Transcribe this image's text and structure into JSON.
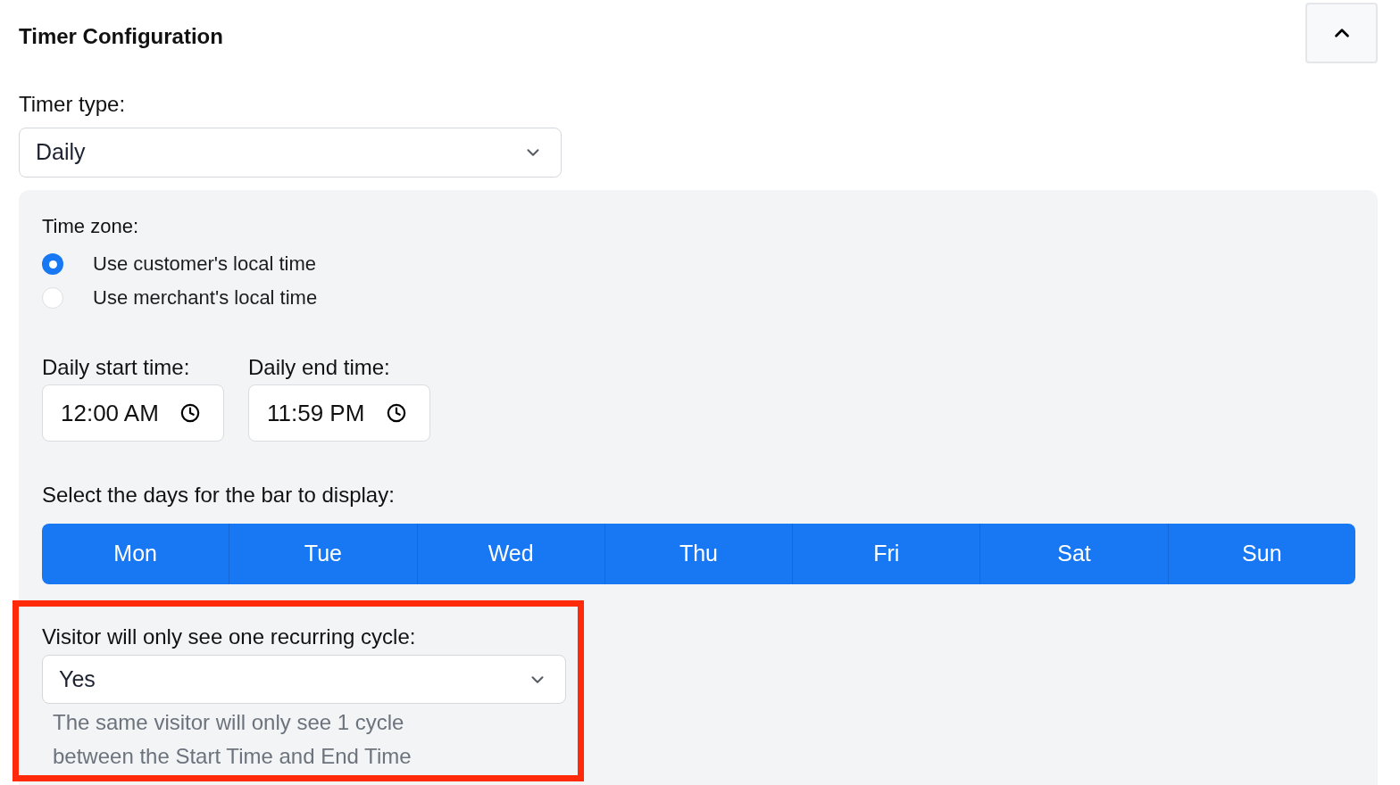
{
  "header": {
    "title": "Timer Configuration",
    "expanded": true
  },
  "timer_type": {
    "label": "Timer type:",
    "value": "Daily"
  },
  "time_zone": {
    "label": "Time zone:",
    "options": [
      {
        "label": "Use customer's local time",
        "selected": true
      },
      {
        "label": "Use merchant's local time",
        "selected": false
      }
    ]
  },
  "times": [
    {
      "label": "Daily start time:",
      "value": "12:00 AM"
    },
    {
      "label": "Daily end time:",
      "value": "11:59 PM"
    }
  ],
  "days": {
    "label": "Select the days for the bar to display:",
    "items": [
      {
        "label": "Mon",
        "selected": true
      },
      {
        "label": "Tue",
        "selected": true
      },
      {
        "label": "Wed",
        "selected": true
      },
      {
        "label": "Thu",
        "selected": true
      },
      {
        "label": "Fri",
        "selected": true
      },
      {
        "label": "Sat",
        "selected": true
      },
      {
        "label": "Sun",
        "selected": true
      }
    ]
  },
  "recurring": {
    "label": "Visitor will only see one recurring cycle:",
    "value": "Yes",
    "help": "The same visitor will only see 1 cycle between the Start Time and End Time",
    "highlighted": true
  }
}
